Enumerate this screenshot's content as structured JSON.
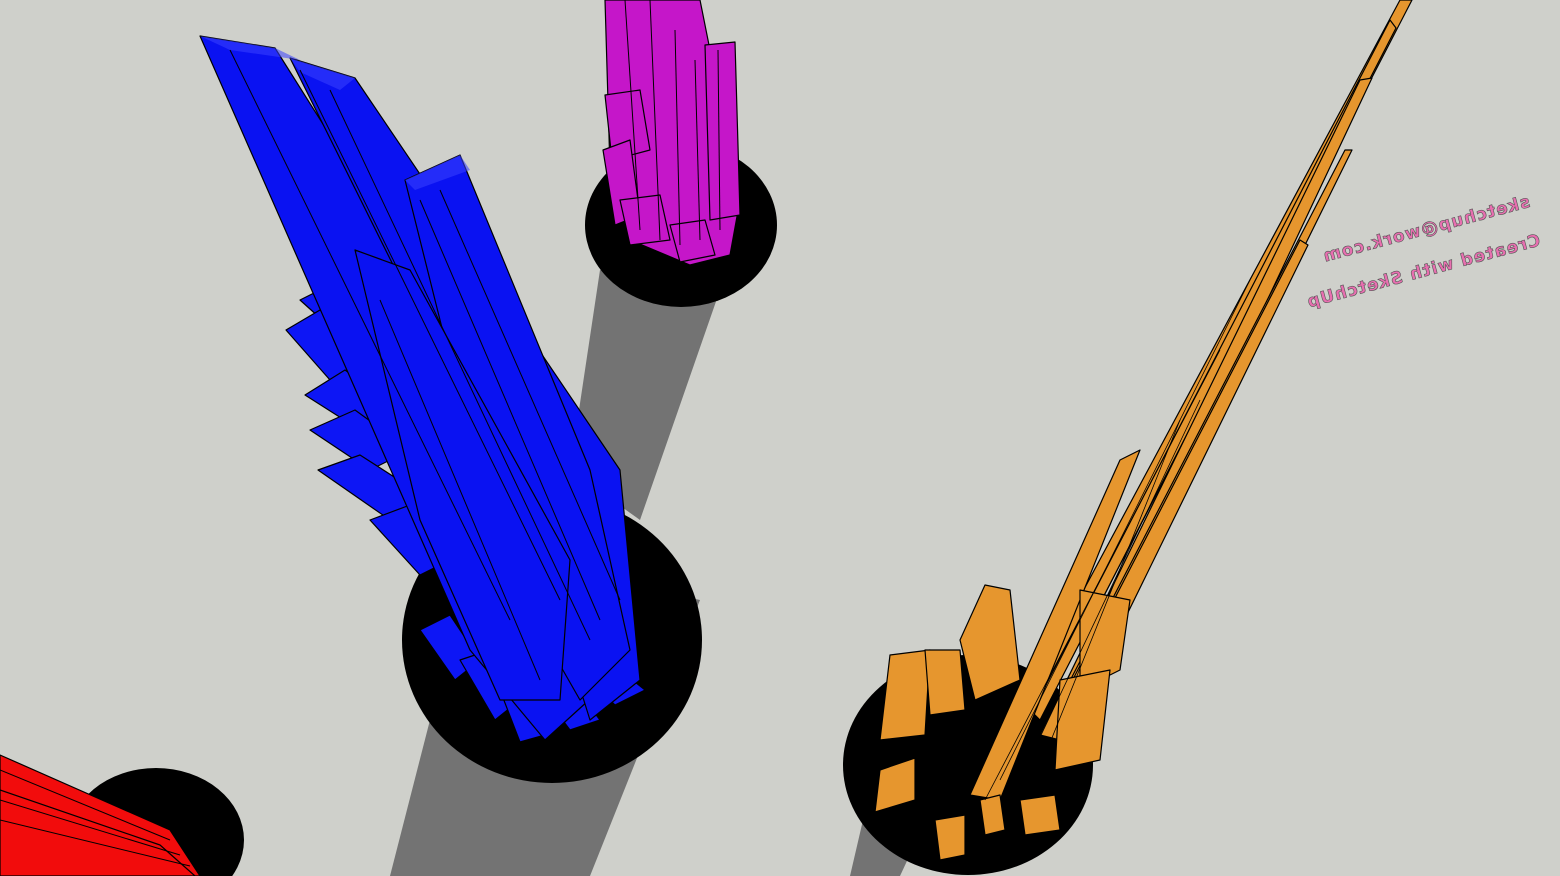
{
  "scene": {
    "background": "#cfd0cb",
    "shadow_color": "#737373",
    "base_color": "#000000",
    "towers": [
      {
        "name": "blue-tower",
        "color": "#0a12f2"
      },
      {
        "name": "magenta-tower",
        "color": "#c516c9"
      },
      {
        "name": "orange-tower",
        "color": "#e6962e"
      },
      {
        "name": "red-tower",
        "color": "#f20c0c"
      }
    ],
    "floor_text": {
      "line1": "Created with SketchUp",
      "line2": "sketchup@work.com"
    },
    "text_color": "#e86fb0"
  }
}
